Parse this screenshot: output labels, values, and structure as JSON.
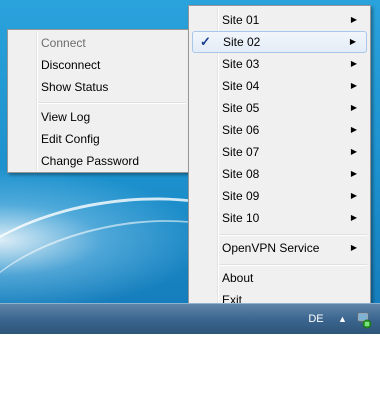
{
  "context_menu": {
    "items": [
      {
        "label": "Connect",
        "enabled": false
      },
      {
        "label": "Disconnect",
        "enabled": true
      },
      {
        "label": "Show Status",
        "enabled": true
      },
      {
        "label": "View Log",
        "enabled": true
      },
      {
        "label": "Edit Config",
        "enabled": true
      },
      {
        "label": "Change Password",
        "enabled": true
      }
    ]
  },
  "tray_menu": {
    "sites": [
      {
        "label": "Site 01",
        "checked": false
      },
      {
        "label": "Site 02",
        "checked": true
      },
      {
        "label": "Site 03",
        "checked": false
      },
      {
        "label": "Site 04",
        "checked": false
      },
      {
        "label": "Site 05",
        "checked": false
      },
      {
        "label": "Site 06",
        "checked": false
      },
      {
        "label": "Site 07",
        "checked": false
      },
      {
        "label": "Site 08",
        "checked": false
      },
      {
        "label": "Site 09",
        "checked": false
      },
      {
        "label": "Site 10",
        "checked": false
      }
    ],
    "service_label": "OpenVPN Service",
    "about_label": "About",
    "exit_label": "Exit",
    "check_glyph": "✓",
    "submenu_arrow": "▶"
  },
  "taskbar": {
    "language": "DE",
    "tray_expand_glyph": "▲",
    "tray_icon": "openvpn-connected-icon"
  },
  "colors": {
    "menu_bg": "#f0f0f0",
    "highlight_border": "#a8c7ea",
    "check": "#1a3f8f",
    "desktop": "#1c90cc"
  }
}
